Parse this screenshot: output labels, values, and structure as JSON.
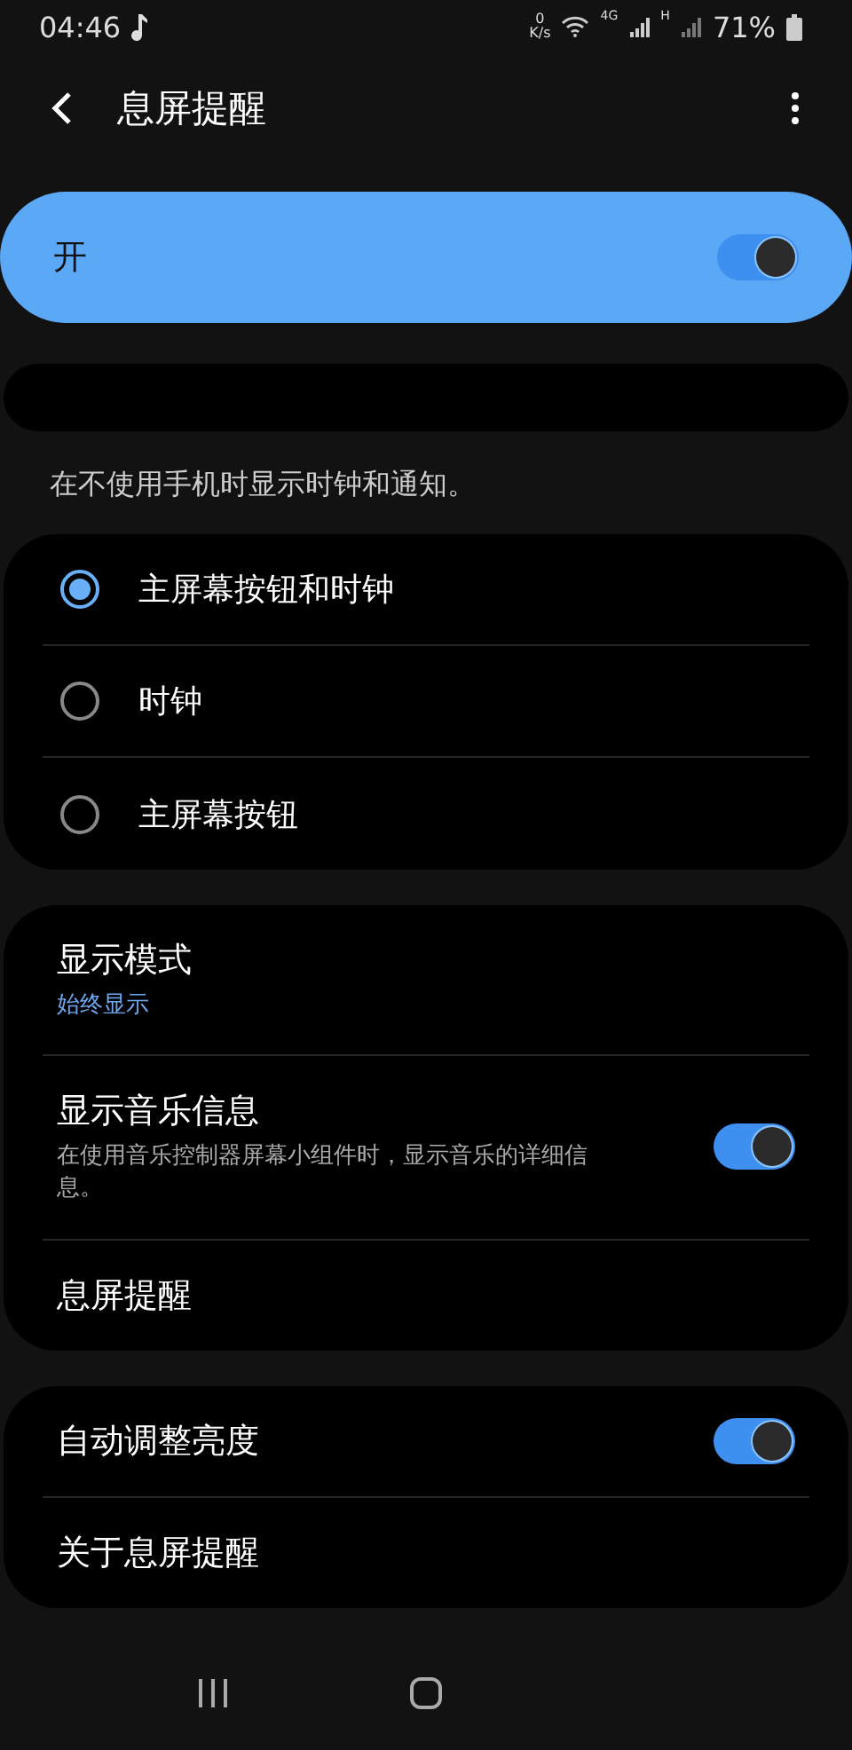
{
  "status_bar": {
    "time": "04:46",
    "speed_value": "0",
    "speed_unit": "K/s",
    "network_1": "4G",
    "network_2": "H",
    "battery": "71%"
  },
  "header": {
    "title": "息屏提醒"
  },
  "master": {
    "label": "开",
    "on": true
  },
  "description": "在不使用手机时显示时钟和通知。",
  "modes": [
    {
      "label": "主屏幕按钮和时钟",
      "selected": true
    },
    {
      "label": "时钟",
      "selected": false
    },
    {
      "label": "主屏幕按钮",
      "selected": false
    }
  ],
  "settings": [
    {
      "kind": "summary",
      "title": "显示模式",
      "summary": "始终显示"
    },
    {
      "kind": "switch",
      "title": "显示音乐信息",
      "summary": "在使用音乐控制器屏幕小组件时，显示音乐的详细信息。",
      "on": true
    },
    {
      "kind": "plain",
      "title": "息屏提醒"
    }
  ],
  "more": [
    {
      "kind": "switch",
      "title": "自动调整亮度",
      "on": true
    },
    {
      "kind": "plain",
      "title": "关于息屏提醒"
    }
  ]
}
